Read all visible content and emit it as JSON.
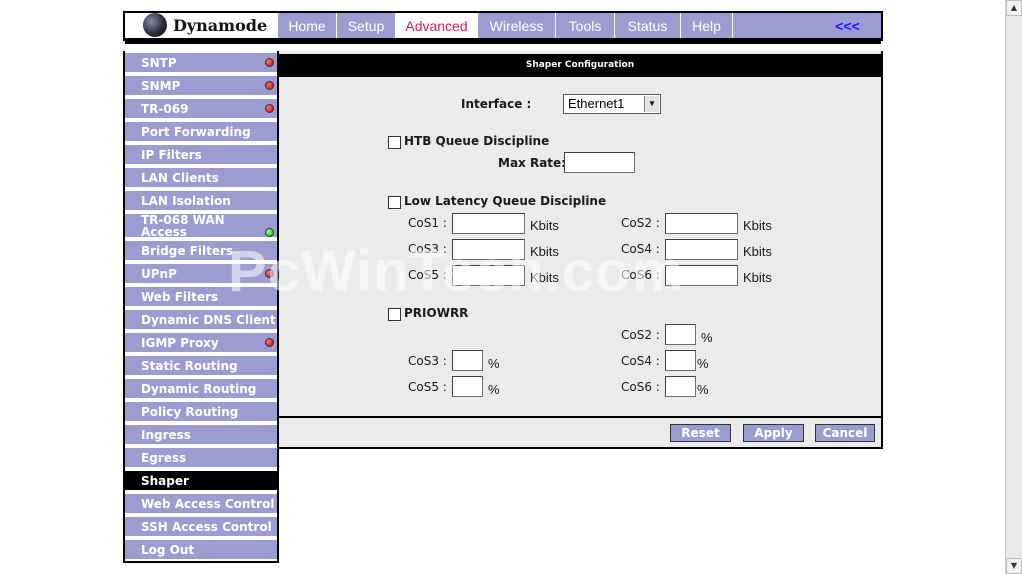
{
  "brand": {
    "name": "Dynamode"
  },
  "nav": {
    "tabs": [
      "Home",
      "Setup",
      "Advanced",
      "Wireless",
      "Tools",
      "Status",
      "Help"
    ],
    "active": "Advanced",
    "collapse_label": "<<<"
  },
  "sidebar": {
    "items": [
      {
        "label": "SNTP",
        "status": "red"
      },
      {
        "label": "SNMP",
        "status": "red"
      },
      {
        "label": "TR-069",
        "status": "red"
      },
      {
        "label": "Port Forwarding",
        "status": ""
      },
      {
        "label": "IP Filters",
        "status": ""
      },
      {
        "label": "LAN Clients",
        "status": ""
      },
      {
        "label": "LAN Isolation",
        "status": ""
      },
      {
        "label": "TR-068 WAN Access",
        "status": "green"
      },
      {
        "label": "Bridge Filters",
        "status": ""
      },
      {
        "label": "UPnP",
        "status": "red"
      },
      {
        "label": "Web Filters",
        "status": ""
      },
      {
        "label": "Dynamic DNS Client",
        "status": ""
      },
      {
        "label": "IGMP Proxy",
        "status": "red"
      },
      {
        "label": "Static Routing",
        "status": ""
      },
      {
        "label": "Dynamic Routing",
        "status": ""
      },
      {
        "label": "Policy Routing",
        "status": ""
      },
      {
        "label": "Ingress",
        "status": ""
      },
      {
        "label": "Egress",
        "status": ""
      },
      {
        "label": "Shaper",
        "status": "",
        "active": true
      },
      {
        "label": "Web Access Control",
        "status": ""
      },
      {
        "label": "SSH Access Control",
        "status": ""
      },
      {
        "label": "Log Out",
        "status": ""
      }
    ]
  },
  "shaper": {
    "title": "Shaper Configuration",
    "interface_label": "Interface :",
    "interface_value": "Ethernet1",
    "htb": {
      "label": "HTB Queue Discipline",
      "max_rate_label": "Max Rate:",
      "max_rate_value": ""
    },
    "llq": {
      "label": "Low Latency Queue Discipline",
      "unit": "Kbits",
      "rows": [
        {
          "left": "CoS1 :",
          "right": "CoS2 :"
        },
        {
          "left": "CoS3 :",
          "right": "CoS4 :"
        },
        {
          "left": "CoS5 :",
          "right": "CoS6 :"
        }
      ]
    },
    "priowrr": {
      "label": "PRIOWRR",
      "unit": "%",
      "cos2": "CoS2 :",
      "cos3": "CoS3 :",
      "cos4": "CoS4 :",
      "cos5": "CoS5 :",
      "cos6": "CoS6 :"
    },
    "buttons": {
      "reset": "Reset",
      "apply": "Apply",
      "cancel": "Cancel"
    }
  },
  "watermark": "PcWinTech.com",
  "colors": {
    "nav_bg": "#9c9cd0",
    "active_tab_text": "#cc1f5e",
    "link": "#1a1aff"
  }
}
